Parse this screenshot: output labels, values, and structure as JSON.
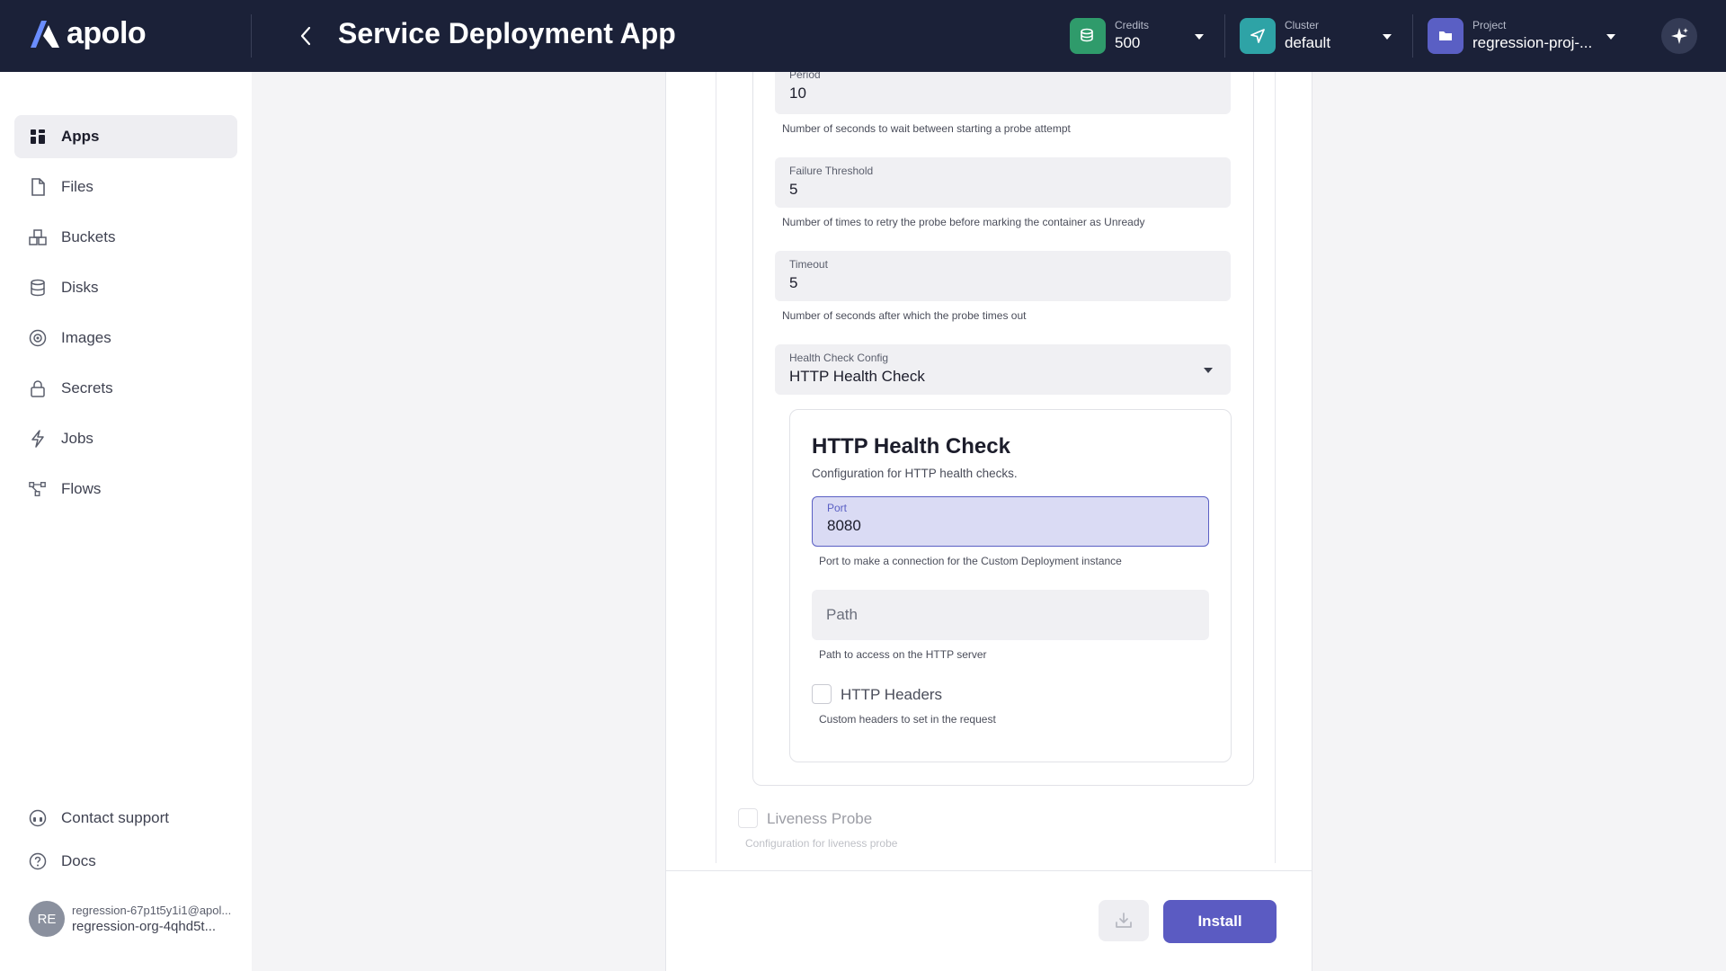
{
  "app": {
    "logo_text": "apolo",
    "page_title": "Service Deployment App"
  },
  "header": {
    "credits": {
      "caption": "Credits",
      "value": "500",
      "color": "#2f9b6b"
    },
    "cluster": {
      "caption": "Cluster",
      "value": "default",
      "color": "#2ea3a6"
    },
    "project": {
      "caption": "Project",
      "value": "regression-proj-...",
      "color": "#5a5fc4"
    }
  },
  "sidebar": {
    "items": [
      {
        "label": "Apps",
        "icon": "apps-grid-icon",
        "active": true
      },
      {
        "label": "Files",
        "icon": "file-icon"
      },
      {
        "label": "Buckets",
        "icon": "buckets-icon"
      },
      {
        "label": "Disks",
        "icon": "database-icon"
      },
      {
        "label": "Images",
        "icon": "image-disc-icon"
      },
      {
        "label": "Secrets",
        "icon": "lock-icon"
      },
      {
        "label": "Jobs",
        "icon": "lightning-icon"
      },
      {
        "label": "Flows",
        "icon": "flows-icon"
      }
    ],
    "footer": [
      {
        "label": "Contact support",
        "icon": "headset-icon"
      },
      {
        "label": "Docs",
        "icon": "help-circle-icon"
      }
    ],
    "user": {
      "initials": "RE",
      "email": "regression-67p1t5y1i1@apol...",
      "org": "regression-org-4qhd5t..."
    }
  },
  "form": {
    "period": {
      "caption": "Period",
      "value": "10",
      "help": "Number of seconds to wait between starting a probe attempt"
    },
    "failure_threshold": {
      "caption": "Failure Threshold",
      "value": "5",
      "help": "Number of times to retry the probe before marking the container as Unready"
    },
    "timeout": {
      "caption": "Timeout",
      "value": "5",
      "help": "Number of seconds after which the probe times out"
    },
    "health_check_config": {
      "caption": "Health Check Config",
      "value": "HTTP Health Check"
    },
    "http_card": {
      "title": "HTTP Health Check",
      "description": "Configuration for HTTP health checks.",
      "port": {
        "caption": "Port",
        "value": "8080",
        "help": "Port to make a connection for the Custom Deployment instance"
      },
      "path": {
        "placeholder": "Path",
        "help": "Path to access on the HTTP server"
      },
      "headers": {
        "label": "HTTP Headers",
        "help": "Custom headers to set in the request"
      }
    },
    "liveness": {
      "label": "Liveness Probe",
      "help": "Configuration for liveness probe"
    }
  },
  "footer": {
    "install_label": "Install"
  }
}
